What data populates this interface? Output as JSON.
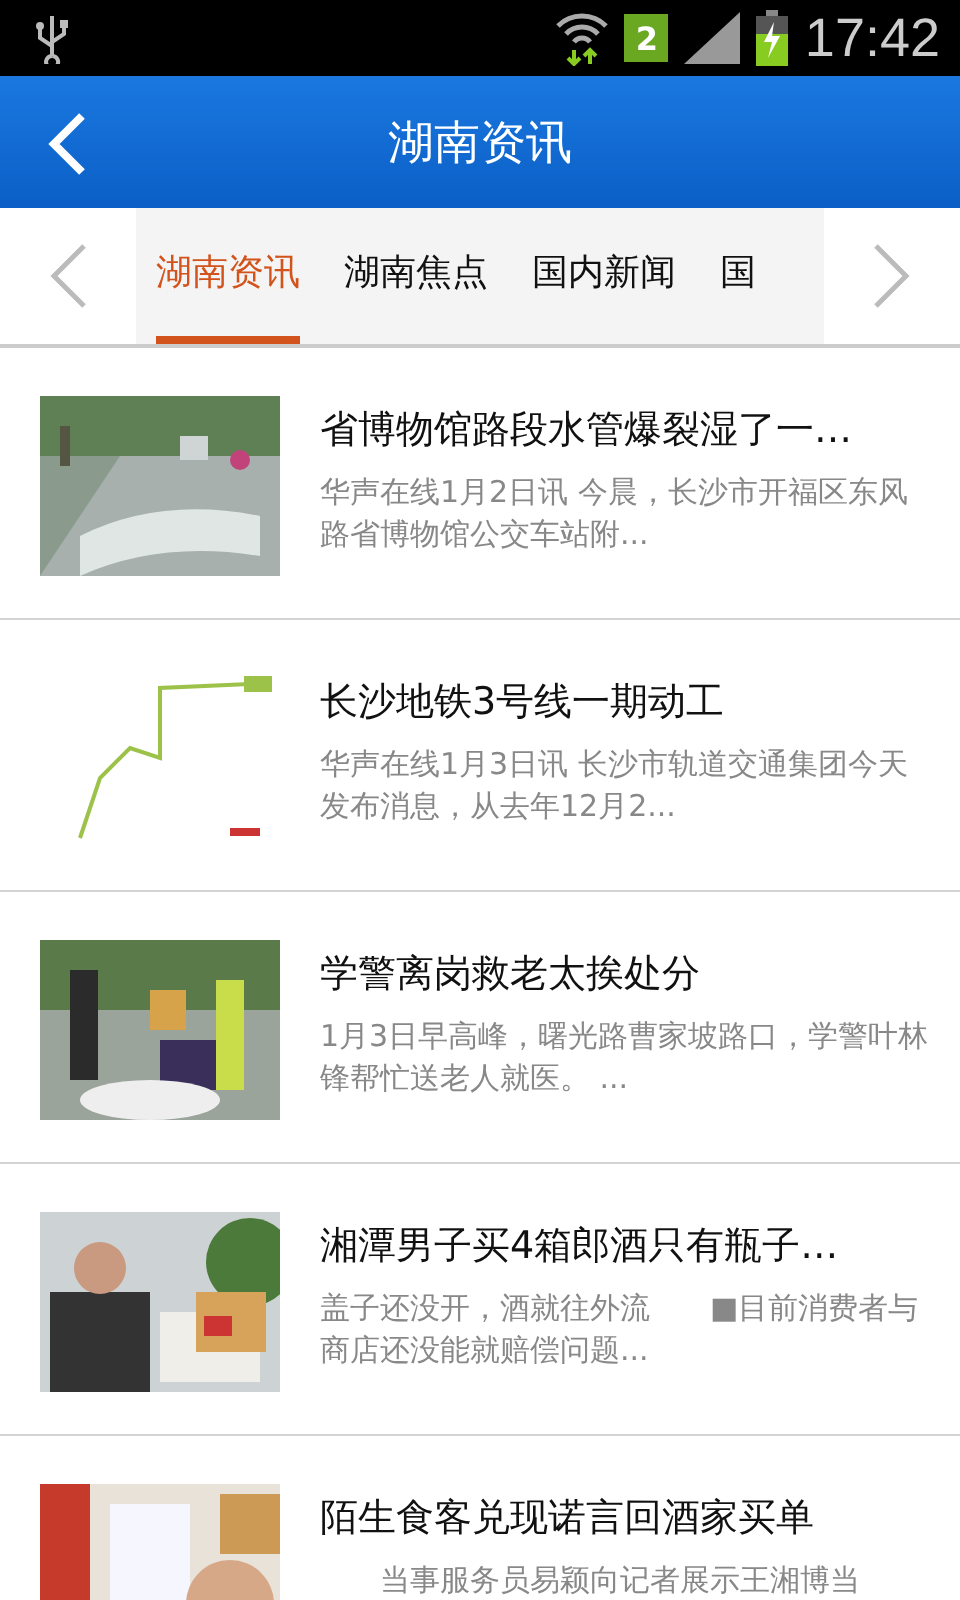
{
  "status_bar": {
    "sim_badge": "2",
    "time": "17:42"
  },
  "header": {
    "title": "湖南资讯"
  },
  "tabs": [
    {
      "label": "湖南资讯",
      "selected": true
    },
    {
      "label": "湖南焦点",
      "selected": false
    },
    {
      "label": "国内新闻",
      "selected": false
    },
    {
      "label": "国",
      "selected": false
    }
  ],
  "news": [
    {
      "title": "省博物馆路段水管爆裂湿了一…",
      "summary": "华声在线1月2日讯 今晨，长沙市开福区东风路省博物馆公交车站附..."
    },
    {
      "title": "长沙地铁3号线一期动工",
      "summary": "华声在线1月3日讯 长沙市轨道交通集团今天发布消息，从去年12月2..."
    },
    {
      "title": "学警离岗救老太挨处分",
      "summary": "1月3日早高峰，曙光路曹家坡路口，学警叶林锋帮忙送老人就医。 ..."
    },
    {
      "title": "湘潭男子买4箱郎酒只有瓶子…",
      "summary": "盖子还没开，酒就往外流　　■目前消费者与商店还没能就赔偿问题..."
    },
    {
      "title": "陌生食客兑现诺言回酒家买单",
      "summary": "　　当事服务员易颖向记者展示王湘博当"
    }
  ]
}
